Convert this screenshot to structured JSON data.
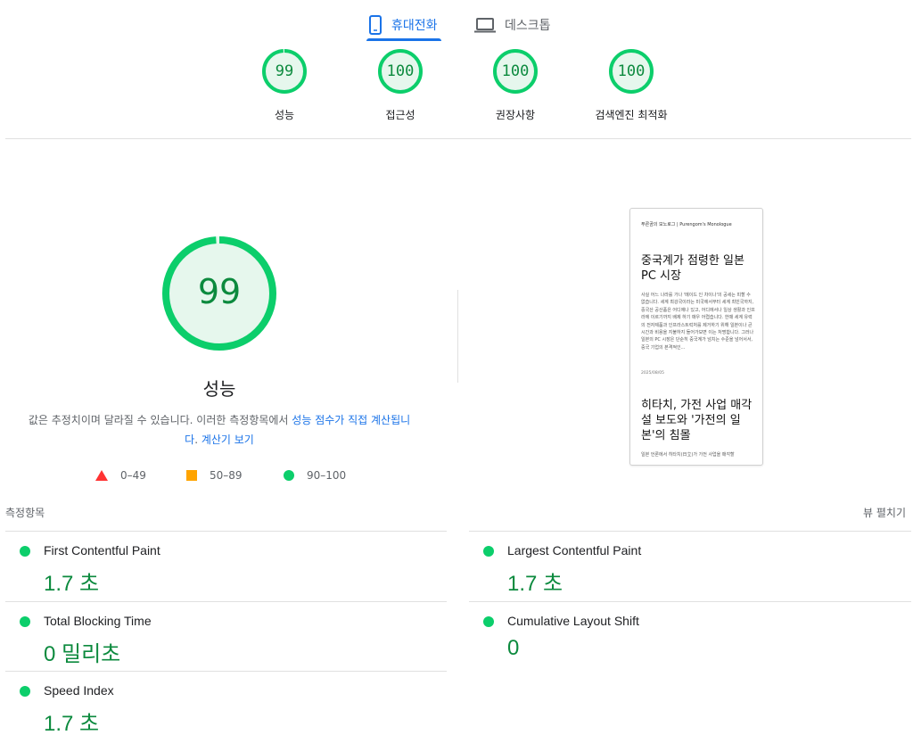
{
  "colors": {
    "pass": "#0cce6b",
    "pass_text": "#0c8a3e",
    "accent": "#1a73e8",
    "fail": "#ff3333",
    "average": "#ffa400"
  },
  "tabs": [
    {
      "label": "휴대전화",
      "icon": "smartphone-icon",
      "active": true
    },
    {
      "label": "데스크톱",
      "icon": "laptop-icon",
      "active": false
    }
  ],
  "categories": [
    {
      "score": "99",
      "label": "성능",
      "fraction": 0.99
    },
    {
      "score": "100",
      "label": "접근성",
      "fraction": 1.0
    },
    {
      "score": "100",
      "label": "권장사항",
      "fraction": 1.0
    },
    {
      "score": "100",
      "label": "검색엔진 최적화",
      "fraction": 1.0
    }
  ],
  "performance": {
    "score": "99",
    "fraction": 0.99,
    "title": "성능",
    "desc_text": "값은 추정치이며 달라질 수 있습니다. 이러한 측정항목에서 ",
    "desc_link1": "성능 점수가 직접 계산됩니다",
    "desc_sep": ". ",
    "desc_link2": "계산기 보기"
  },
  "legend": [
    {
      "shape": "triangle",
      "range": "0–49"
    },
    {
      "shape": "square",
      "range": "50–89"
    },
    {
      "shape": "circle",
      "range": "90–100"
    }
  ],
  "preview": {
    "site_title": "푸른곰의 모노로그 | Purengom's Monologue",
    "post1_title": "중국계가 점령한 일본 PC 시장",
    "post1_excerpt": "사실 어느 나라를 가나 '메이드 인 차이나'의 공세는 피할 수 없습니다. 세계 최강국이라는 미국에서부터 세계 최빈국까지, 중국산 공산품은 어디에나 있고, 어디에서나 일상 생활과 인프라에 이르기까지 배제 하기 매우 어렵습니다. 한때 세계 유력의 전자제품과 인프라스트럭처를 제거하기 위해 일본이나 큰 시간과 비용을 지불하지 들어가보면 이는 처명합니다. 그러나 일본의 PC 시장은 단순히 중국계가 넘치는 수준을 넘어서서, 중국 기업의 본격적인...",
    "post1_date": "2025/08/05",
    "post2_title": "히타치, 가전 사업 매각설 보도와 '가전의 일본'의 침몰",
    "post2_excerpt": "일본 언론에서 히타치(日立)가 가전 사업을 매각할"
  },
  "metrics": {
    "title": "측정항목",
    "expand_label": "뷰 펼치기",
    "items": [
      {
        "name": "First Contentful Paint",
        "value": "1.7 초"
      },
      {
        "name": "Largest Contentful Paint",
        "value": "1.7 초"
      },
      {
        "name": "Total Blocking Time",
        "value": "0 밀리초"
      },
      {
        "name": "Cumulative Layout Shift",
        "value": "0"
      },
      {
        "name": "Speed Index",
        "value": "1.7 초"
      }
    ]
  }
}
